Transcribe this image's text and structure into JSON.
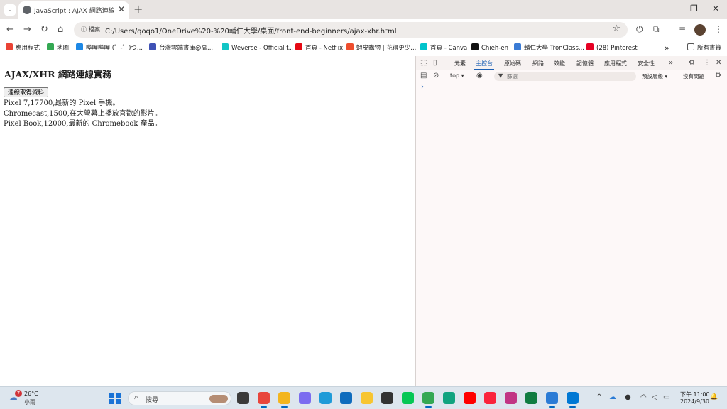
{
  "browser": {
    "tab": {
      "title": "JavaScript : AJAX 網路連線實務",
      "close_glyph": "✕"
    },
    "tab_menu_glyph": "⌄",
    "new_tab_glyph": "+",
    "window_controls": {
      "minimize": "—",
      "restore": "❐",
      "close": "✕"
    },
    "nav": {
      "back": "←",
      "forward": "→",
      "reload": "↻",
      "home": "⌂"
    },
    "omnibox": {
      "site_chip": "檔案",
      "url": "C:/Users/qoqo1/OneDrive%20-%20輔仁大學/桌面/front-end-beginners/ajax-xhr.html",
      "star_glyph": "☆"
    },
    "toolbar_icons": {
      "power": "⏻",
      "extensions": "⧉",
      "media": "≡",
      "menu": "⋮"
    }
  },
  "bookmarks": [
    {
      "label": "應用程式",
      "icon": "apps-icon",
      "color": "#ea4335"
    },
    {
      "label": "地圖",
      "icon": "maps-icon",
      "color": "#34a853"
    },
    {
      "label": "哔哩哔哩 (゜-゜)つ...",
      "icon": "bilibili-icon",
      "color": "#1e88e5"
    },
    {
      "label": "台灣雲端書庫@高...",
      "icon": "book-icon",
      "color": "#3f51b5"
    },
    {
      "label": "Weverse - Official f...",
      "icon": "weverse-icon",
      "color": "#12c5c5"
    },
    {
      "label": "首頁 - Netflix",
      "icon": "netflix-icon",
      "color": "#e50914"
    },
    {
      "label": "蝦皮購物 | 花得更少...",
      "icon": "shopee-icon",
      "color": "#ee4d2d"
    },
    {
      "label": "首頁 - Canva",
      "icon": "canva-icon",
      "color": "#00c4cc"
    },
    {
      "label": "Chieh-en",
      "icon": "notion-icon",
      "color": "#111111"
    },
    {
      "label": "輔仁大學 TronClass...",
      "icon": "tronclass-icon",
      "color": "#3a7bd5"
    },
    {
      "label": "(28) Pinterest",
      "icon": "pinterest-icon",
      "color": "#e60023"
    }
  ],
  "bookmarks_more": "»",
  "bookmarks_folder": "所有書籤",
  "page": {
    "heading": "AJAX/XHR 網路連線實務",
    "fetch_button": "連線取得資料",
    "results": [
      "Pixel 7,17700,最新的 Pixel 手機。",
      "Chromecast,1500,在大螢幕上播放喜歡的影片。",
      "Pixel Book,12000,最新的 Chromebook 產品。"
    ]
  },
  "devtools": {
    "icons": {
      "inspect": "⬚",
      "device": "▯",
      "more_tabs": "»",
      "settings": "⚙",
      "menu": "⋮",
      "close": "✕",
      "sidebar": "▤",
      "clear": "⊘",
      "eye": "◉",
      "filter": "▼"
    },
    "tabs": [
      "元素",
      "主控台",
      "原始碼",
      "網路",
      "效能",
      "記憶體",
      "應用程式",
      "安全性"
    ],
    "active_tab": "主控台",
    "context": "top ▾",
    "filter_placeholder": "篩選",
    "levels": "預設層級 ▾",
    "issues": "沒有問題",
    "prompt": "›"
  },
  "taskbar": {
    "weather_badge": "7",
    "weather_temp": "26°C",
    "weather_condition": "小雨",
    "search_label": "搜尋",
    "search_glyph": "⌕",
    "tray": {
      "chevron": "^",
      "wifi": "◠",
      "volume": "◁",
      "battery": "▭",
      "notify": "🔔"
    },
    "clock_time": "下午 11:00",
    "clock_date": "2024/9/30",
    "apps": [
      {
        "name": "task-view-app",
        "color": "#3a3a3a"
      },
      {
        "name": "chrome-app",
        "color": "#e8453c"
      },
      {
        "name": "file-explorer-app",
        "color": "#f3b51e"
      },
      {
        "name": "copilot-app",
        "color": "#7b6cf0"
      },
      {
        "name": "edge-app",
        "color": "#1f9bd8"
      },
      {
        "name": "outlook-app",
        "color": "#0f6cbd"
      },
      {
        "name": "notes-app",
        "color": "#f7c531"
      },
      {
        "name": "sticky-app",
        "color": "#333333"
      },
      {
        "name": "line-app",
        "color": "#06c755"
      },
      {
        "name": "drive-app",
        "color": "#34a853"
      },
      {
        "name": "chatgpt-app",
        "color": "#10a37f"
      },
      {
        "name": "youtube-app",
        "color": "#ff0000"
      },
      {
        "name": "music-app",
        "color": "#fa243c"
      },
      {
        "name": "instagram-app",
        "color": "#c13584"
      },
      {
        "name": "excel-app",
        "color": "#107c41"
      },
      {
        "name": "shark-app",
        "color": "#2a7bd5"
      },
      {
        "name": "vscode-app",
        "color": "#0078d4"
      }
    ]
  }
}
